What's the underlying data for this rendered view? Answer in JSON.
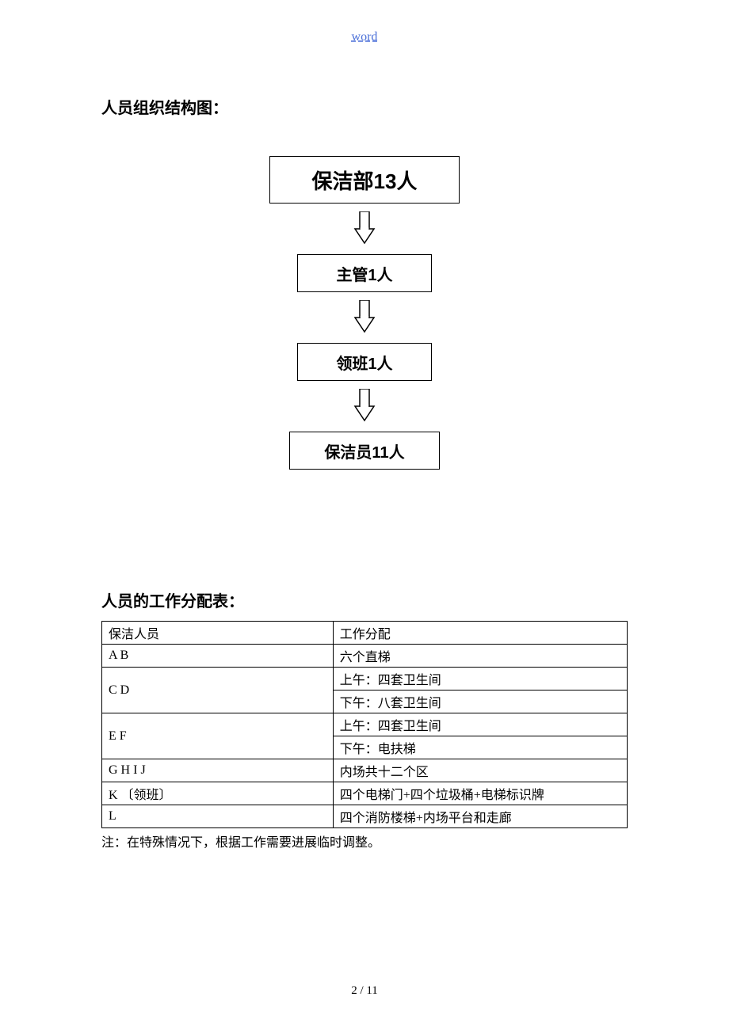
{
  "header": {
    "link_text": "word"
  },
  "sections": {
    "org_title": "人员组织结构图：",
    "table_title": "人员的工作分配表："
  },
  "org_chart": {
    "nodes": [
      "保洁部13人",
      "主管1人",
      "领班1人",
      "保洁员11人"
    ]
  },
  "table": {
    "header": {
      "c1": "保洁人员",
      "c2": "工作分配"
    },
    "rows": [
      {
        "c1": "A    B",
        "c2": "六个直梯",
        "rs": 1
      },
      {
        "c1": "C    D",
        "c2": "上午：四套卫生间",
        "rs": 2
      },
      {
        "c1": null,
        "c2": "下午：八套卫生间"
      },
      {
        "c1": "E    F",
        "c2": "上午：四套卫生间",
        "rs": 2
      },
      {
        "c1": null,
        "c2": "下午：电扶梯"
      },
      {
        "c1": "G    H     I     J",
        "c2": "内场共十二个区",
        "rs": 1
      },
      {
        "c1": "K 〔领班〕",
        "c2": "四个电梯门+四个垃圾桶+电梯标识牌",
        "rs": 1
      },
      {
        "c1": "L",
        "c2": "四个消防楼梯+内场平台和走廊",
        "rs": 1
      }
    ]
  },
  "note": "注：在特殊情况下，根据工作需要进展临时调整。",
  "footer": {
    "page": "2  /  11"
  }
}
